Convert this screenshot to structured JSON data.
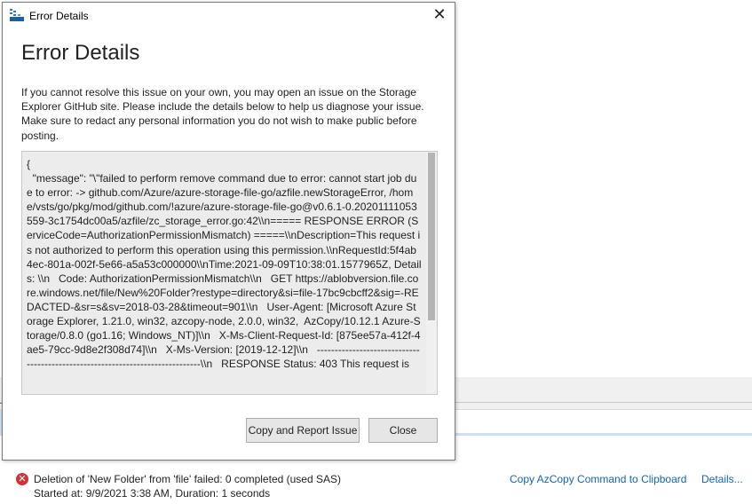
{
  "background": {
    "activity": {
      "status_icon": "error-circle-icon",
      "title": "Deletion of 'New Folder' from 'file' failed: 0 completed (used SAS)",
      "subtitle": "Started at: 9/9/2021 3:38 AM, Duration: 1 seconds",
      "copy_link": "Copy AzCopy Command to Clipboard",
      "details_link": "Details..."
    }
  },
  "dialog": {
    "title": "Error Details",
    "app_icon": "storage-explorer-icon",
    "heading": "Error Details",
    "description": "If you cannot resolve this issue on your own, you may open an issue on the Storage Explorer GitHub site. Please include the details below to help us diagnose your issue. Make sure to redact any personal information you do not wish to make public before posting.",
    "error_text": "{\n  \"message\": \"\\\"failed to perform remove command due to error: cannot start job due to error: -> github.com/Azure/azure-storage-file-go/azfile.newStorageError, /home/vsts/go/pkg/mod/github.com/!azure/azure-storage-file-go@v0.6.1-0.20201111053559-3c1754dc00a5/azfile/zc_storage_error.go:42\\\\n===== RESPONSE ERROR (ServiceCode=AuthorizationPermissionMismatch) =====\\\\nDescription=This request is not authorized to perform this operation using this permission.\\\\nRequestId:5f4ab4ec-801a-002f-5e66-a5a53c000000\\\\nTime:2021-09-09T10:38:01.1577965Z, Details: \\\\n   Code: AuthorizationPermissionMismatch\\\\n   GET https://ablobversion.file.core.windows.net/file/New%20Folder?restype=directory&si=file-17bc9cbcff2&sig=-REDACTED-&sr=s&sv=2018-03-28&timeout=901\\\\n   User-Agent: [Microsoft Azure Storage Explorer, 1.21.0, win32, azcopy-node, 2.0.0, win32,  AzCopy/10.12.1 Azure-Storage/0.8.0 (go1.16; Windows_NT)]\\\\n   X-Ms-Client-Request-Id: [875ee57a-412f-4ae5-79cc-9d8e2f308d74]\\\\n   X-Ms-Version: [2019-12-12]\\\\n   ------------------------------------------------------------------------------\\\\n   RESPONSE Status: 403 This request is",
    "buttons": {
      "copy_report": "Copy and Report Issue",
      "close": "Close"
    },
    "close_icon": "close-icon"
  }
}
